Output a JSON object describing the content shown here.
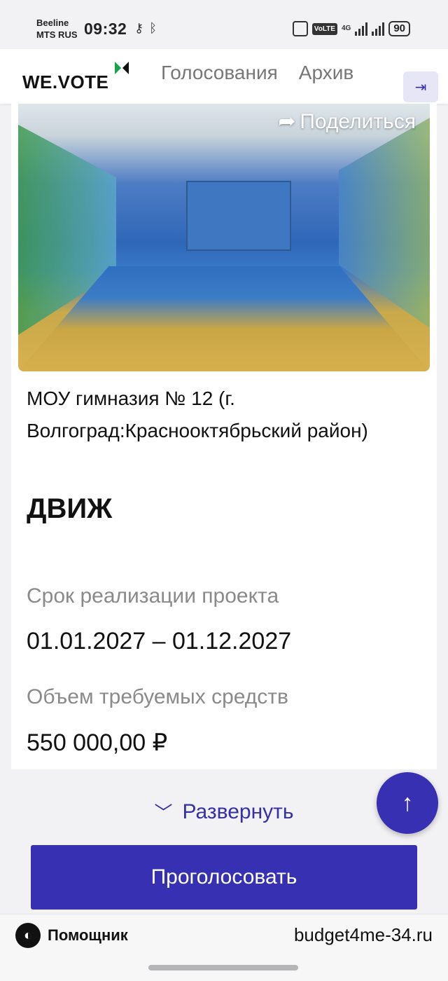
{
  "status_bar": {
    "carrier_1": "Beeline",
    "carrier_2": "MTS RUS",
    "time": "09:32",
    "battery": "90",
    "volte": "VoLTE",
    "lte": "4G"
  },
  "header": {
    "logo": "WE.VOTE",
    "nav_items": [
      "Голосования",
      "Архив"
    ]
  },
  "card": {
    "share_label": "Поделиться",
    "school": "МОУ гимназия № 12 (г. Волгоград:Краснооктябрьский район)",
    "project_title": "ДВИЖ",
    "term_label": "Срок реализации проекта",
    "term_value": "01.01.2027 – 01.12.2027",
    "funds_label": "Объем требуемых средств",
    "funds_value": "550 000,00 ₽"
  },
  "expand_label": "Развернуть",
  "vote_button": "Проголосовать",
  "footer": {
    "assistant_label": "Помощник",
    "domain": "budget4me-34.ru"
  },
  "colors": {
    "accent": "#3730b3",
    "muted_text": "#8a8a8a"
  }
}
